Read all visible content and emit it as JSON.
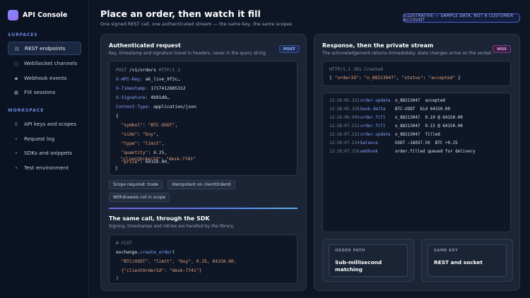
{
  "sidebar": {
    "app_title": "API Console",
    "sections": [
      {
        "heading": "SURFACES",
        "items": [
          {
            "label": "REST endpoints",
            "icon": "list-icon",
            "glyph": "▤",
            "active": true
          },
          {
            "label": "WebSocket channels",
            "icon": "socket-icon",
            "glyph": "▢",
            "active": false
          },
          {
            "label": "Webhook events",
            "icon": "diamond-icon",
            "glyph": "◆",
            "active": false
          },
          {
            "label": "FIX sessions",
            "icon": "grid-icon",
            "glyph": "▦",
            "active": false
          }
        ]
      },
      {
        "heading": "WORKSPACE",
        "items": [
          {
            "label": "API keys and scopes",
            "icon": "key-icon",
            "glyph": "⚲",
            "active": false
          },
          {
            "label": "Request log",
            "icon": "dot-icon",
            "glyph": "•",
            "active": false
          },
          {
            "label": "SDKs and snippets",
            "icon": "dot-icon",
            "glyph": "•",
            "active": false
          },
          {
            "label": "Test environment",
            "icon": "dot-icon",
            "glyph": "•",
            "active": false
          }
        ]
      }
    ]
  },
  "header": {
    "title": "Place an order, then watch it fill",
    "subtitle": "One signed REST call, one authenticated stream — the same key, the same scopes",
    "badge": "ILLUSTRATIVE — SAMPLE DATA, NOT A CUSTOMER ACCOUNT"
  },
  "left_panel": {
    "title": "Authenticated request",
    "description": "Key, timestamp and signature travel in headers, never in the query string.",
    "method_badge": "POST",
    "request": {
      "method": "POST",
      "path": "/v1/orders",
      "protocol": "HTTP/1.1",
      "headers": [
        {
          "name": "X-API-Key:",
          "value": "ak_live_9f2c…"
        },
        {
          "name": "X-Timestamp:",
          "value": "1717412885312"
        },
        {
          "name": "X-Signature:",
          "value": "4b91d0…"
        },
        {
          "name": "Content-Type:",
          "value": "application/json"
        }
      ],
      "body_open": "{",
      "body": [
        {
          "key": "\"symbol\"",
          "value": "\"BTC-USDT\"",
          "comma": ","
        },
        {
          "key": "\"side\"",
          "value": "\"buy\"",
          "comma": ","
        },
        {
          "key": "\"type\"",
          "value": "\"limit\"",
          "comma": ","
        },
        {
          "key": "\"quantity\"",
          "value": "0.25",
          "comma": ","
        },
        {
          "key": "\"price\"",
          "value": "64150.00",
          "comma": ","
        },
        {
          "key": "\"clientOrderId\"",
          "value": "\"desk-7741\"",
          "comma": ""
        }
      ],
      "body_close": "}"
    },
    "chips": [
      "Scope required: trade",
      "Idempotent on clientOrderId",
      "Withdrawals not in scope"
    ],
    "sdk_title": "The same call, through the SDK",
    "sdk_description": "Signing, timestamps and retries are handled by the library.",
    "sdk_code": {
      "comment": "# CCXT",
      "obj": "exchange.",
      "fn": "create_order",
      "paren_open": "(",
      "args": "\"BTC/USDT\", \"limit\", \"buy\", 0.25, 64150.00,",
      "params": "{\"clientOrderId\": \"desk-7741\"}",
      "paren_close": ")"
    }
  },
  "right_panel": {
    "title": "Response, then the private stream",
    "description": "The acknowledgement returns immediately; state changes arrive on the socket.",
    "method_badge": "WSS",
    "response": {
      "status_line": "HTTP/1.1 201 Created",
      "body_open": "{ ",
      "order_key": "\"orderId\"",
      "order_value": "\"o_88213047\"",
      "status_key": "\"status\"",
      "status_value": "\"accepted\"",
      "body_close": " }"
    },
    "stream": [
      {
        "ts": "12:28:05.312",
        "event": "order.update",
        "msg": "o_88213047  accepted"
      },
      {
        "ts": "12:28:05.318",
        "event": "book.delta",
        "msg": "BTC-USDT  bid 64150.00"
      },
      {
        "ts": "12:28:06.904",
        "event": "order.fill",
        "msg": "o_88213047  0.10 @ 64150.00"
      },
      {
        "ts": "12:28:07.211",
        "event": "order.fill",
        "msg": "o_88213047  0.15 @ 64150.00"
      },
      {
        "ts": "12:28:07.212",
        "event": "order.update",
        "msg": "o_88213047  filled"
      },
      {
        "ts": "12:28:07.214",
        "event": "balance",
        "msg": "USDT −16037.50  BTC +0.25"
      },
      {
        "ts": "12:28:07.216",
        "event": "webhook",
        "msg": "order.filled queued for delivery"
      }
    ],
    "cards": [
      {
        "label": "ORDER PATH",
        "value": "Sub-millisecond matching"
      },
      {
        "label": "SAME KEY",
        "value": "REST and socket"
      }
    ]
  },
  "colors": {
    "background": "#0e1626",
    "panel": "#1b2536",
    "accent": "#8aa2ff",
    "string": "#e8a37c",
    "wss_badge": "#e39ae8"
  }
}
